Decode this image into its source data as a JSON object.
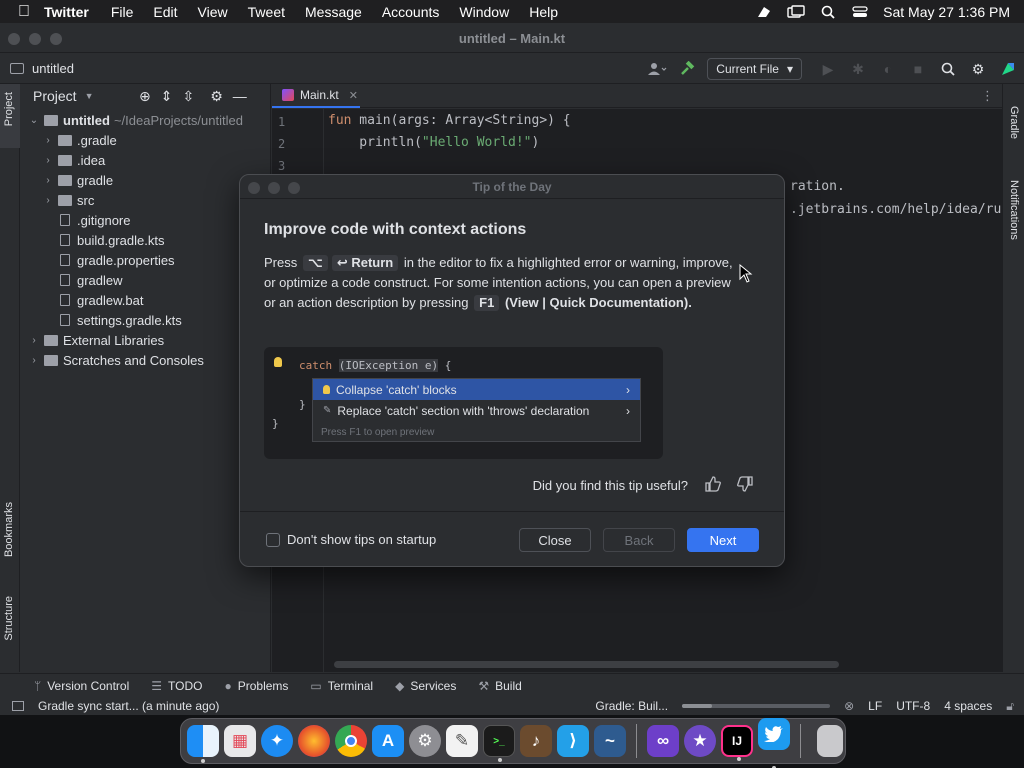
{
  "menubar": {
    "app_name": "Twitter",
    "items": [
      "File",
      "Edit",
      "View",
      "Tweet",
      "Message",
      "Accounts",
      "Window",
      "Help"
    ],
    "datetime": "Sat May 27  1:36 PM"
  },
  "window": {
    "title": "untitled – Main.kt"
  },
  "toolbar": {
    "project_name": "untitled",
    "run_config": "Current File"
  },
  "left_strip": {
    "project_label": "Project",
    "bookmarks_label": "Bookmarks",
    "structure_label": "Structure"
  },
  "right_strip": {
    "gradle_label": "Gradle",
    "notifications_label": "Notifications"
  },
  "project_panel": {
    "title": "Project",
    "root": {
      "name": "untitled",
      "path": "~/IdeaProjects/untitled"
    },
    "items": [
      {
        "label": ".gradle",
        "type": "folder"
      },
      {
        "label": ".idea",
        "type": "folder"
      },
      {
        "label": "gradle",
        "type": "folder"
      },
      {
        "label": "src",
        "type": "folder"
      },
      {
        "label": ".gitignore",
        "type": "file"
      },
      {
        "label": "build.gradle.kts",
        "type": "file"
      },
      {
        "label": "gradle.properties",
        "type": "file"
      },
      {
        "label": "gradlew",
        "type": "file"
      },
      {
        "label": "gradlew.bat",
        "type": "file"
      },
      {
        "label": "settings.gradle.kts",
        "type": "file"
      }
    ],
    "external_libraries": "External Libraries",
    "scratches": "Scratches and Consoles"
  },
  "editor": {
    "tab_label": "Main.kt",
    "line_numbers": [
      "1",
      "2",
      "3"
    ],
    "line1_kw": "fun",
    "line1_rest": " main(args: Array<String>) {",
    "line2_fn": "    println(",
    "line2_str": "\"Hello World!\"",
    "line2_end": ")",
    "partial_line4": "ration.",
    "partial_line5": ".jetbrains.com/help/idea/ru"
  },
  "dialog": {
    "title": "Tip of the Day",
    "heading": "Improve code with context actions",
    "body_press": "Press",
    "key_alt": "⌥",
    "key_return": "↩ Return",
    "body_mid": "in the editor to fix a highlighted error or warning, improve, or optimize a code construct. For some intention actions, you can open a preview or an action description by pressing",
    "key_f1": "F1",
    "body_paren": "(View | Quick Documentation).",
    "preview": {
      "code_catch": "catch",
      "code_param": "(IOException e)",
      "code_brace": "{",
      "code_close1": "}",
      "code_close2": "}",
      "option1": "Collapse 'catch' blocks",
      "option2": "Replace 'catch' section with 'throws' declaration",
      "hint": "Press F1 to open preview"
    },
    "feedback_question": "Did you find this tip useful?",
    "checkbox_label": "Don't show tips on startup",
    "close_label": "Close",
    "back_label": "Back",
    "next_label": "Next"
  },
  "bottom_tools": [
    {
      "label": "Version Control",
      "icon": "branch-icon"
    },
    {
      "label": "TODO",
      "icon": "list-icon"
    },
    {
      "label": "Problems",
      "icon": "warning-icon"
    },
    {
      "label": "Terminal",
      "icon": "terminal-icon"
    },
    {
      "label": "Services",
      "icon": "services-icon"
    },
    {
      "label": "Build",
      "icon": "hammer-icon"
    }
  ],
  "statusbar": {
    "message": "Gradle sync start... (a minute ago)",
    "task": "Gradle: Buil...",
    "progress": 0.2,
    "line_sep": "LF",
    "encoding": "UTF-8",
    "indent": "4 spaces"
  },
  "dock": {
    "apps": [
      "Finder",
      "Launchpad",
      "Safari",
      "Firefox",
      "Chrome",
      "App Store",
      "System Preferences",
      "TextEdit",
      "Terminal",
      "Instruments",
      "VS Code",
      "Wireshark",
      "Visual Studio",
      "iMovie",
      "IntelliJ IDEA",
      "Twitter",
      "Trash"
    ]
  },
  "colors": {
    "accent": "#3574f0",
    "selection": "#2e55a5",
    "keyword": "#cf8e6d",
    "string": "#6aab73"
  }
}
